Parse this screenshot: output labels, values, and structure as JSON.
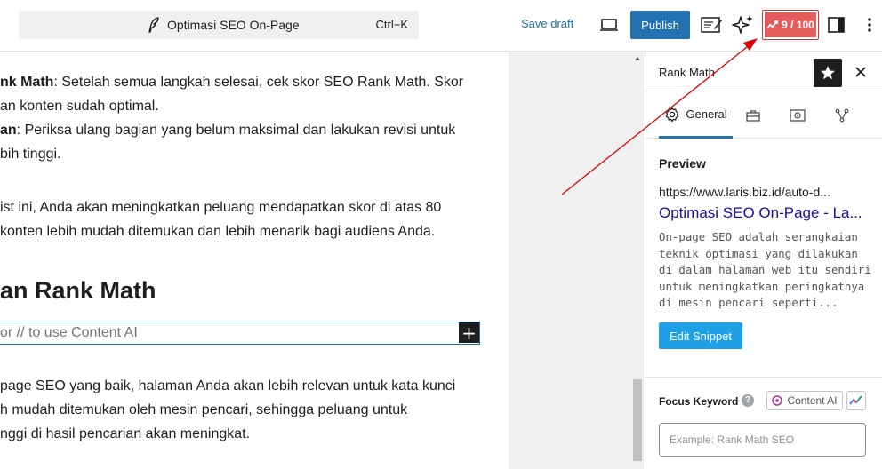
{
  "toolbar": {
    "document_title": "Optimasi SEO On-Page",
    "shortcut": "Ctrl+K",
    "save_draft": "Save draft",
    "publish": "Publish",
    "seo_score": "9 / 100"
  },
  "editor": {
    "paragraphs": [
      {
        "bold": "nk Math",
        "text": ": Setelah semua langkah selesai, cek skor SEO Rank Math. Skor"
      },
      {
        "bold": "",
        "text": "an konten sudah optimal."
      },
      {
        "bold": "an",
        "text": ": Periksa ulang bagian yang belum maksimal dan lakukan revisi untuk"
      },
      {
        "bold": "",
        "text": "bih tinggi."
      },
      {
        "bold": "",
        "text": "ist ini, Anda akan meningkatkan peluang mendapatkan skor di atas 80"
      },
      {
        "bold": "",
        "text": " konten lebih mudah ditemukan dan lebih menarik bagi audiens Anda."
      }
    ],
    "heading": "an Rank Math",
    "ai_placeholder": "or // to use Content AI",
    "closing": [
      "page SEO yang baik, halaman Anda akan lebih relevan untuk kata kunci",
      "h mudah ditemukan oleh mesin pencari, sehingga peluang untuk",
      "nggi di hasil pencarian akan meningkat."
    ]
  },
  "panel": {
    "title": "Rank Math",
    "tabs": [
      {
        "label": "General",
        "icon": "gear-icon"
      },
      {
        "label": "",
        "icon": "toolbox-icon"
      },
      {
        "label": "",
        "icon": "schema-icon"
      },
      {
        "label": "",
        "icon": "social-icon"
      }
    ],
    "preview": {
      "heading": "Preview",
      "url": "https://www.laris.biz.id/auto-d...",
      "title": "Optimasi SEO On-Page - La...",
      "description": "On-page SEO adalah serangkaian teknik optimasi yang dilakukan di dalam halaman web itu sendiri untuk meningkatkan peringkatnya di mesin pencari seperti...",
      "edit_button": "Edit Snippet"
    },
    "focus_keyword": {
      "label": "Focus Keyword",
      "help": "?",
      "content_ai": "Content AI",
      "placeholder": "Example: Rank Math SEO"
    }
  },
  "colors": {
    "accent": "#2271b1",
    "score_bad": "#e35c5c",
    "snippet_title": "#1a0dab",
    "edit_snippet": "#1ea0e6",
    "annotation_arrow": "#e00000"
  }
}
